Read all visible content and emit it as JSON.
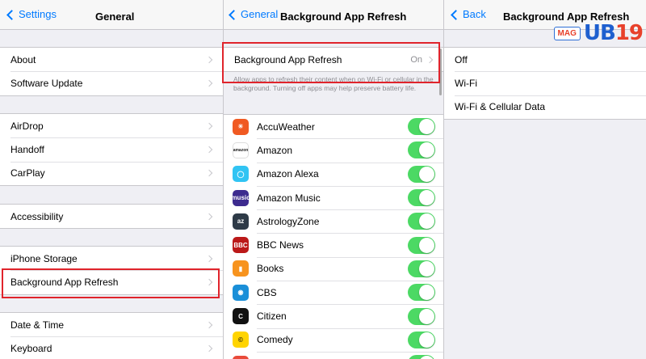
{
  "panel1": {
    "nav": {
      "back_label": "Settings",
      "title": "General"
    },
    "groups": [
      [
        "About",
        "Software Update"
      ],
      [
        "AirDrop",
        "Handoff",
        "CarPlay"
      ],
      [
        "Accessibility"
      ],
      [
        "iPhone Storage",
        "Background App Refresh"
      ],
      [
        "Date & Time",
        "Keyboard"
      ]
    ]
  },
  "panel2": {
    "nav": {
      "back_label": "General",
      "title": "Background App Refresh"
    },
    "setting": {
      "label": "Background App Refresh",
      "value": "On"
    },
    "footer": "Allow apps to refresh their content when on Wi-Fi or cellular in the background. Turning off apps may help preserve battery life.",
    "apps": [
      {
        "name": "AccuWeather",
        "icon": "accuweather-icon",
        "color": "#f05a22",
        "glyph": "☀",
        "on": true
      },
      {
        "name": "Amazon",
        "icon": "amazon-icon",
        "color": "#ffffff",
        "glyph": "amazon",
        "on": true
      },
      {
        "name": "Amazon Alexa",
        "icon": "alexa-icon",
        "color": "#31c4f3",
        "glyph": "◯",
        "on": true
      },
      {
        "name": "Amazon Music",
        "icon": "amazon-music-icon",
        "color": "#3d2b8f",
        "glyph": "music",
        "on": true
      },
      {
        "name": "AstrologyZone",
        "icon": "astrologyzone-icon",
        "color": "#2e3a47",
        "glyph": "az",
        "on": true
      },
      {
        "name": "BBC News",
        "icon": "bbc-news-icon",
        "color": "#bb1919",
        "glyph": "BBC",
        "on": true
      },
      {
        "name": "Books",
        "icon": "books-icon",
        "color": "#f7931e",
        "glyph": "▮",
        "on": true
      },
      {
        "name": "CBS",
        "icon": "cbs-icon",
        "color": "#1a8fd8",
        "glyph": "◉",
        "on": true
      },
      {
        "name": "Citizen",
        "icon": "citizen-icon",
        "color": "#111111",
        "glyph": "C",
        "on": true
      },
      {
        "name": "Comedy",
        "icon": "comedy-icon",
        "color": "#ffd400",
        "glyph": "©",
        "on": true
      },
      {
        "name": "",
        "icon": "app-icon",
        "color": "#e94a3a",
        "glyph": "",
        "on": true
      }
    ]
  },
  "panel3": {
    "nav": {
      "back_label": "Back",
      "title": "Background App Refresh"
    },
    "options": [
      "Off",
      "Wi-Fi",
      "Wi-Fi & Cellular Data"
    ]
  },
  "logo": {
    "text_a": "MAG",
    "text_b": "UB",
    "text_c": "19"
  }
}
